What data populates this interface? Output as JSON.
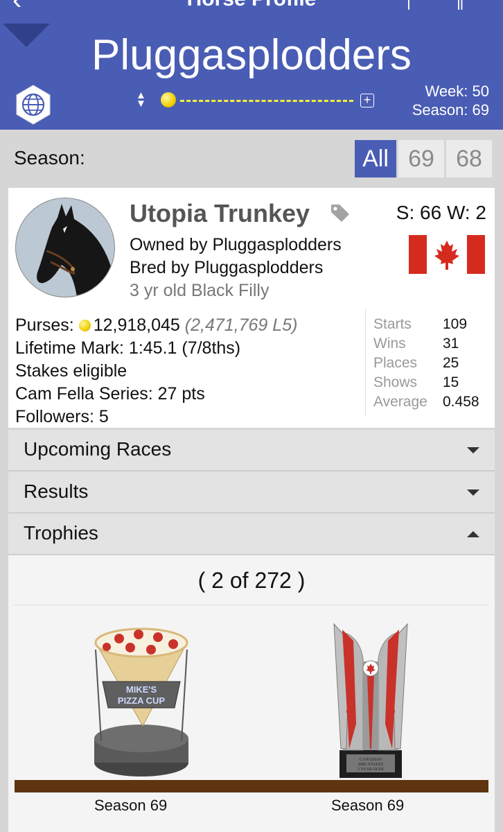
{
  "nav": {
    "title": "Horse Profile"
  },
  "header": {
    "stable_name": "Pluggasplodders",
    "week": "Week: 50",
    "season": "Season: 69"
  },
  "season_filter": {
    "label": "Season:",
    "options": [
      "All",
      "69",
      "68"
    ],
    "selected": "All"
  },
  "horse": {
    "name": "Utopia Trunkey",
    "starts_wins": "S: 66 W: 2",
    "owned_by": "Owned by Pluggasplodders",
    "bred_by": "Bred by Pluggasplodders",
    "age_desc": "3 yr old Black Filly",
    "purses_label": "Purses:",
    "purses_value": "12,918,045",
    "purses_l5": "(2,471,769 L5)",
    "lifetime_mark": "Lifetime Mark: 1:45.1 (7/8ths)",
    "stakes": "Stakes eligible",
    "series": "Cam Fella Series: 27 pts",
    "followers": "Followers: 5"
  },
  "stats": [
    {
      "label": "Starts",
      "value": "109"
    },
    {
      "label": "Wins",
      "value": "31"
    },
    {
      "label": "Places",
      "value": "25"
    },
    {
      "label": "Shows",
      "value": "15"
    },
    {
      "label": "Average",
      "value": "0.458"
    }
  ],
  "sections": {
    "upcoming": "Upcoming Races",
    "results": "Results",
    "trophies": "Trophies"
  },
  "trophies": {
    "count": "( 2 of 272 )",
    "items": [
      {
        "name": "pizza-cup-trophy",
        "banner": "MIKE'S PIZZA CUP",
        "caption": "Season 69"
      },
      {
        "name": "canadian-sire-stakes-trophy",
        "plaque": "CANADIAN SIRE STAKES 2 YEAR OLDS",
        "caption": "Season 69"
      }
    ]
  },
  "colors": {
    "header": "#4a5db4",
    "accent_yellow": "#f7ef3d",
    "flag_red": "#d52b1e",
    "shelf": "#5e3510"
  },
  "icons": [
    "back-icon",
    "globe-icon",
    "sort-arrows-icon",
    "coin-icon",
    "plus-box-icon",
    "tag-icon",
    "canada-flag-icon",
    "chevron-down-icon",
    "chevron-up-icon"
  ]
}
